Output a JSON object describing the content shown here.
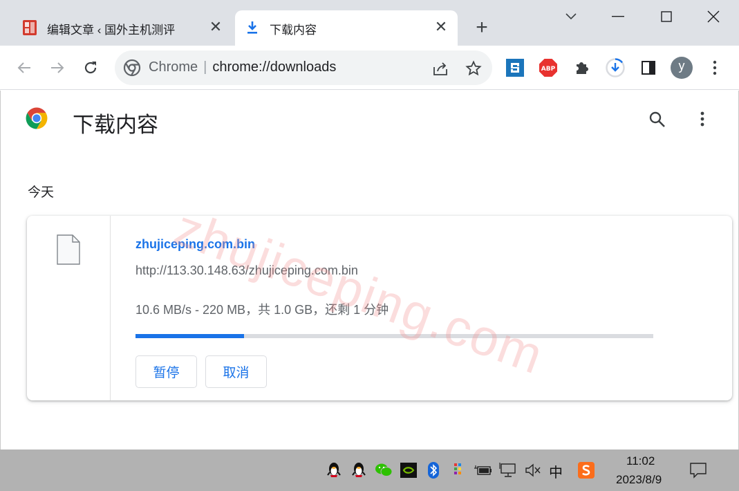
{
  "tabs": [
    {
      "title": "编辑文章 ‹ 国外主机测评",
      "close": "✕"
    },
    {
      "title": "下载内容",
      "close": "✕"
    }
  ],
  "new_tab": "+",
  "omnibox": {
    "site": "Chrome",
    "separator": "|",
    "url": "chrome://downloads"
  },
  "profile_initial": "y",
  "page": {
    "title": "下载内容",
    "date_heading": "今天"
  },
  "download": {
    "file_name": "zhujiceping.com.bin",
    "source_url": "http://113.30.148.63/zhujiceping.com.bin",
    "status": "10.6 MB/s - 220 MB，共 1.0 GB，还剩 1 分钟",
    "progress_fraction": 0.21,
    "pause_label": "暂停",
    "cancel_label": "取消"
  },
  "watermark": "zhujiceping.com",
  "taskbar": {
    "ime": "中",
    "time": "11:02",
    "date": "2023/8/9"
  },
  "colors": {
    "accent": "#1a73e8",
    "tabstrip": "#dee1e6",
    "taskbar": "#b2b2b2",
    "abp_red": "#e8322f"
  }
}
